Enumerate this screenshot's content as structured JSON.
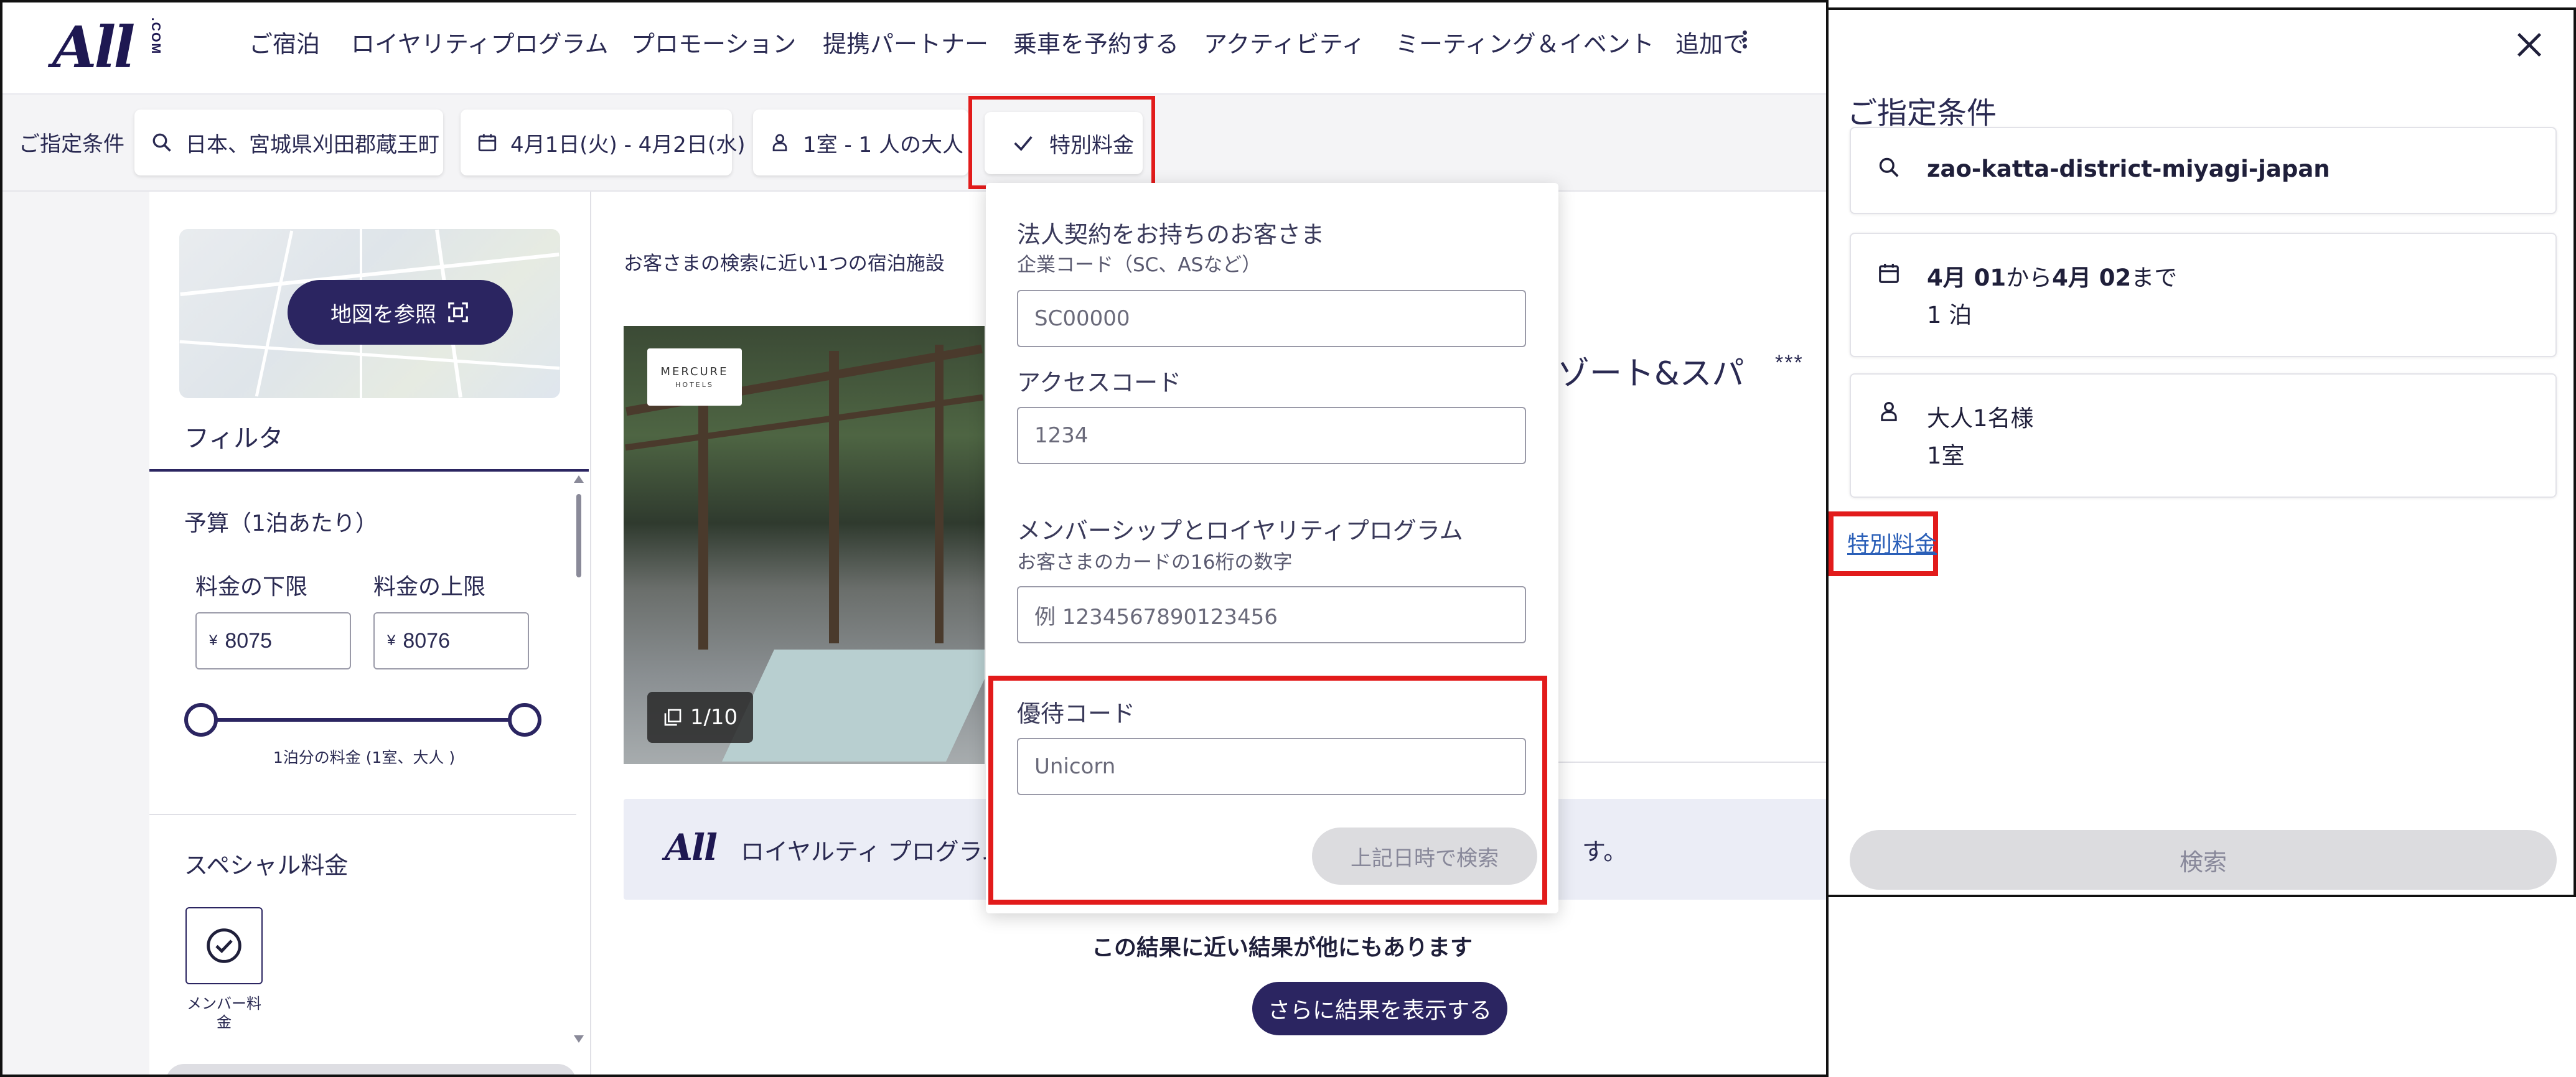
{
  "nav": {
    "logo_text": "All",
    "logo_com": ".COM",
    "items": [
      "ご宿泊",
      "ロイヤリティプログラム",
      "プロモーション",
      "提携パートナー",
      "乗車を予約する",
      "アクティビティ",
      "ミーティング＆イベント",
      "追加で"
    ]
  },
  "searchbar": {
    "label": "ご指定条件",
    "destination": "日本、宮城県刈田郡蔵王町",
    "dates": "4月1日(火) - 4月2日(水)",
    "guests": "1室 - 1 人の大人",
    "special_rate": "特別料金"
  },
  "sidebar": {
    "map_button": "地図を参照",
    "filter_title": "フィルタ",
    "budget_title": "予算（1泊あたり）",
    "min_label": "料金の下限",
    "max_label": "料金の上限",
    "currency": "¥",
    "min_value": "8075",
    "max_value": "8076",
    "slider_caption": "1泊分の料金 (1室、大人 )",
    "special_title": "スペシャル料金",
    "member_caption": "メンバー料金"
  },
  "results": {
    "count_text": "お客さまの検索に近い1つの宿泊施設",
    "brand_logo": "MERCURE",
    "brand_sub": "HOTELS",
    "image_counter": "1/10",
    "hotel_name_partial": "リゾート&スパ",
    "stars": "***",
    "loyalty_logo": "All",
    "loyalty_text": "ロイヤルティ プログラム",
    "loyalty_text_end": "す。",
    "more_results_text": "この結果に近い結果が他にもあります",
    "more_results_button": "さらに結果を表示する"
  },
  "dropdown": {
    "corporate_label": "法人契約をお持ちのお客さま",
    "corporate_sub": "企業コード（SC、ASなど）",
    "corporate_placeholder": "SC00000",
    "access_label": "アクセスコード",
    "access_placeholder": "1234",
    "membership_label": "メンバーシップとロイヤリティプログラム",
    "membership_sub": "お客さまのカードの16桁の数字",
    "membership_placeholder": "例 1234567890123456",
    "promo_label": "優待コード",
    "promo_value": "Unicorn",
    "search_button": "上記日時で検索"
  },
  "mobile": {
    "title": "ご指定条件",
    "destination": "zao-katta-district-miyagi-japan",
    "dates_line1_a": "4月 ",
    "dates_line1_b": "01",
    "dates_line1_c": "から",
    "dates_line1_d": "4月 ",
    "dates_line1_e": "02",
    "dates_line1_f": "まで",
    "dates_line2": "1 泊",
    "guests_line1": "大人1名様",
    "guests_line2": "1室",
    "special_link": "特別料金",
    "search_button": "検索"
  },
  "colors": {
    "brand_navy": "#2b2561",
    "highlight_red": "#e21b1b",
    "link_blue": "#2a5fb8"
  }
}
